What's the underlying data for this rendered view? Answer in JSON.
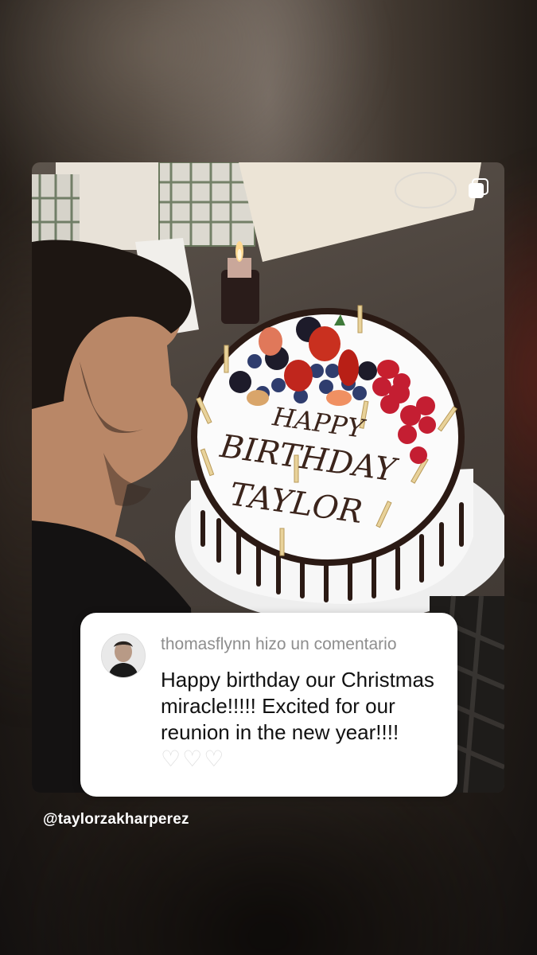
{
  "post": {
    "multi_icon": "carousel-icon",
    "cake_text": [
      "HAPPY",
      "BIRTHDAY",
      "TAYLOR"
    ]
  },
  "comment": {
    "header": "thomasflynn hizo un comentario",
    "body": "Happy birthday our Christmas miracle!!!!! Excited for our reunion in the new year!!!! ",
    "hearts": "♡♡♡"
  },
  "mention": "@taylorzakharperez",
  "colors": {
    "comment_bg": "#ffffff",
    "header_text": "#8e8e8e",
    "body_text": "#111111"
  }
}
